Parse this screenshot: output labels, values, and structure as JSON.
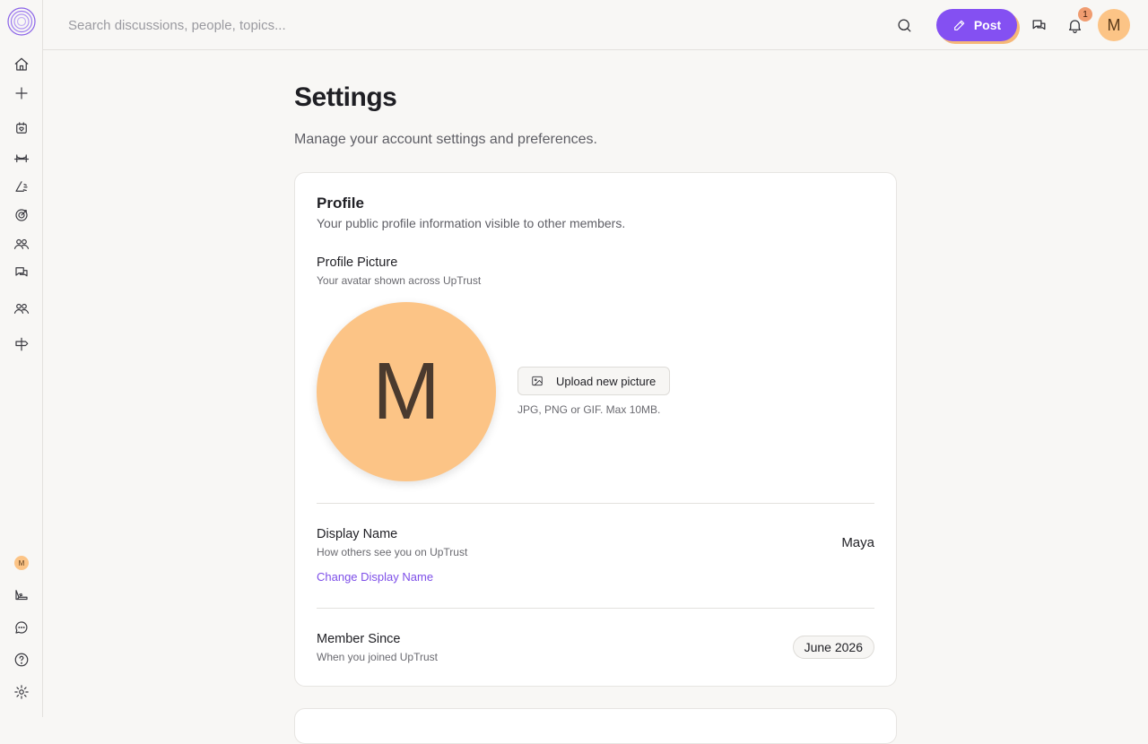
{
  "search": {
    "placeholder": "Search discussions, people, topics..."
  },
  "topbar": {
    "post_label": "Post",
    "notifications_count": "1",
    "avatar_initial": "M"
  },
  "sidebar": {
    "mini_avatar_initial": "M"
  },
  "page": {
    "title": "Settings",
    "subtitle": "Manage your account settings and preferences."
  },
  "profile": {
    "section_title": "Profile",
    "section_desc": "Your public profile information visible to other members.",
    "picture_label": "Profile Picture",
    "picture_hint": "Your avatar shown across UpTrust",
    "avatar_initial": "M",
    "upload_label": "Upload new picture",
    "upload_hint": "JPG, PNG or GIF. Max 10MB.",
    "display_name_label": "Display Name",
    "display_name_hint": "How others see you on UpTrust",
    "display_name_value": "Maya",
    "change_display_name": "Change Display Name",
    "member_since_label": "Member Since",
    "member_since_hint": "When you joined UpTrust",
    "member_since_value": "June 2026"
  },
  "colors": {
    "accent": "#8450f2",
    "avatar_bg": "#fcc486",
    "badge": "#f09c70"
  }
}
